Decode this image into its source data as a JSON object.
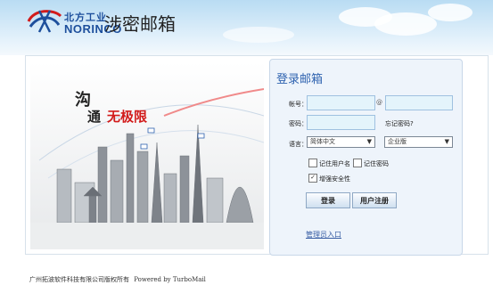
{
  "header": {
    "brand_cn": "北方工业",
    "brand_en": "NORINCO",
    "app_title": "涉密邮箱"
  },
  "hero": {
    "slogan_1": "沟",
    "slogan_2": "通",
    "slogan_3": "无极限"
  },
  "login": {
    "title": "登录邮箱",
    "account_label": "帐号：",
    "account_value": "",
    "at_sign": "@",
    "domain_value": "",
    "password_label": "密码：",
    "password_value": "",
    "forgot_link": "忘记密码?",
    "language_label": "语言：",
    "language_value": "简体中文",
    "edition_value": "企业版",
    "remember_user": "记住用户名",
    "remember_password": "记住密码",
    "enhanced_security": "增强安全性",
    "enhanced_security_checked": true,
    "login_button": "登录",
    "register_button": "用户注册",
    "admin_link": "管理员入口"
  },
  "footer": {
    "copyright": "广州拓波软件科技有限公司版权所有",
    "powered": "Powered by TurboMail"
  },
  "colors": {
    "brand_blue": "#1d4f9c",
    "panel_bg": "#eef4fb",
    "input_bg": "#e4f4fb",
    "link_blue": "#3a5fa5",
    "slogan_red": "#d21b1b"
  }
}
